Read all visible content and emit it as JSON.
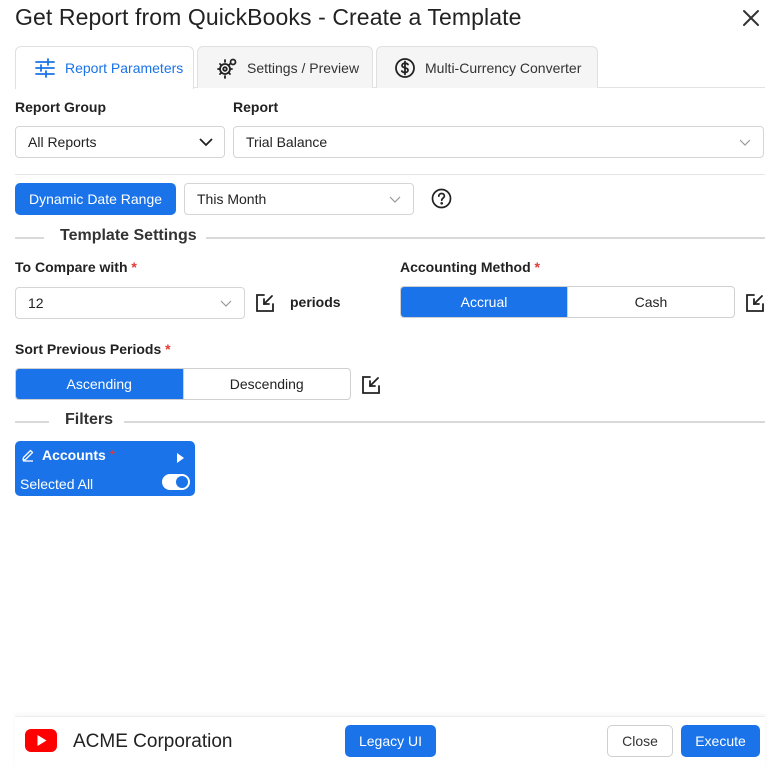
{
  "window": {
    "title": "Get Report from QuickBooks - Create a Template"
  },
  "tabs": [
    {
      "label": "Report Parameters",
      "icon": "sliders-icon",
      "active": true
    },
    {
      "label": "Settings / Preview",
      "icon": "gears-icon",
      "active": false
    },
    {
      "label": "Multi-Currency Converter",
      "icon": "dollar-circle-icon",
      "active": false
    }
  ],
  "report_group": {
    "label": "Report Group",
    "value": "All Reports"
  },
  "report": {
    "label": "Report",
    "value": "Trial Balance"
  },
  "date_range": {
    "button_label": "Dynamic Date Range",
    "value": "This Month",
    "help_icon": "question-circle-icon"
  },
  "template_settings": {
    "section_title": "Template Settings",
    "compare": {
      "label": "To Compare with",
      "required_mark": "*",
      "value": "12",
      "suffix": "periods"
    },
    "accounting_method": {
      "label": "Accounting Method",
      "required_mark": "*",
      "options": [
        "Accrual",
        "Cash"
      ],
      "selected": "Accrual"
    },
    "sort": {
      "label": "Sort Previous Periods",
      "required_mark": "*",
      "options": [
        "Ascending",
        "Descending"
      ],
      "selected": "Ascending"
    }
  },
  "filters": {
    "section_title": "Filters",
    "card": {
      "title": "Accounts",
      "required_mark": "*",
      "status": "Selected All",
      "toggle_on": true
    }
  },
  "footer": {
    "company": "ACME Corporation",
    "legacy_label": "Legacy UI",
    "close_label": "Close",
    "execute_label": "Execute"
  },
  "colors": {
    "primary": "#1a73e8",
    "required": "#e53935",
    "logo_red": "#ff0000"
  }
}
